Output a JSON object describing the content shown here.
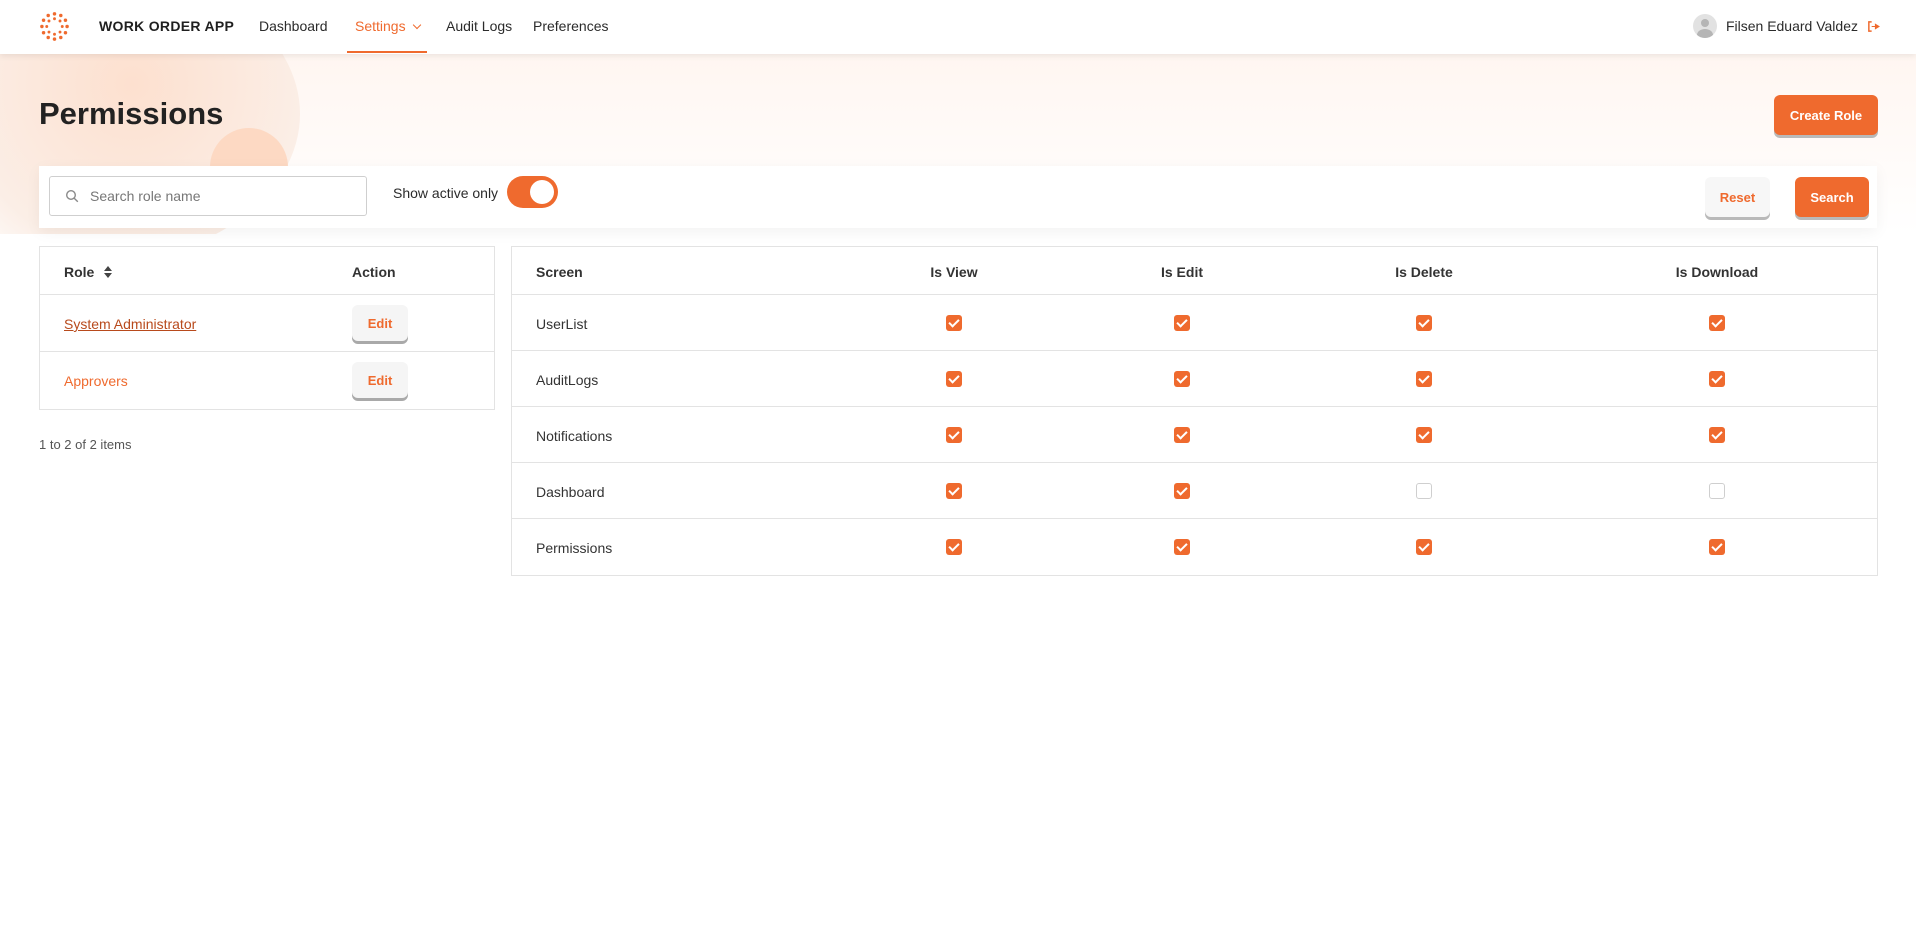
{
  "header": {
    "app_name": "WORK ORDER APP",
    "nav": [
      {
        "label": "Dashboard"
      },
      {
        "label": "Settings"
      },
      {
        "label": "Audit Logs"
      },
      {
        "label": "Preferences"
      }
    ],
    "active_nav": "Settings",
    "user_name": "Filsen Eduard Valdez"
  },
  "page": {
    "title": "Permissions",
    "create_label": "Create Role"
  },
  "filters": {
    "search_placeholder": "Search role name",
    "search_value": "",
    "toggle_label": "Show active only",
    "toggle_on": true,
    "reset_label": "Reset",
    "search_label": "Search"
  },
  "roles": {
    "columns": [
      "Role",
      "Action"
    ],
    "rows": [
      {
        "name": "System Administrator",
        "action": "Edit"
      },
      {
        "name": "Approvers",
        "action": "Edit"
      }
    ],
    "pager": "1 to 2 of 2 items"
  },
  "permissions": {
    "columns": [
      "Screen",
      "Is View",
      "Is Edit",
      "Is Delete",
      "Is Download"
    ],
    "rows": [
      {
        "screen": "UserList",
        "view": true,
        "edit": true,
        "delete": true,
        "download": true
      },
      {
        "screen": "AuditLogs",
        "view": true,
        "edit": true,
        "delete": true,
        "download": true
      },
      {
        "screen": "Notifications",
        "view": true,
        "edit": true,
        "delete": true,
        "download": true
      },
      {
        "screen": "Dashboard",
        "view": true,
        "edit": true,
        "delete": false,
        "download": false
      },
      {
        "screen": "Permissions",
        "view": true,
        "edit": true,
        "delete": true,
        "download": true
      }
    ]
  },
  "colors": {
    "accent": "#ef6a2e",
    "link_dark": "#b84a1c"
  }
}
